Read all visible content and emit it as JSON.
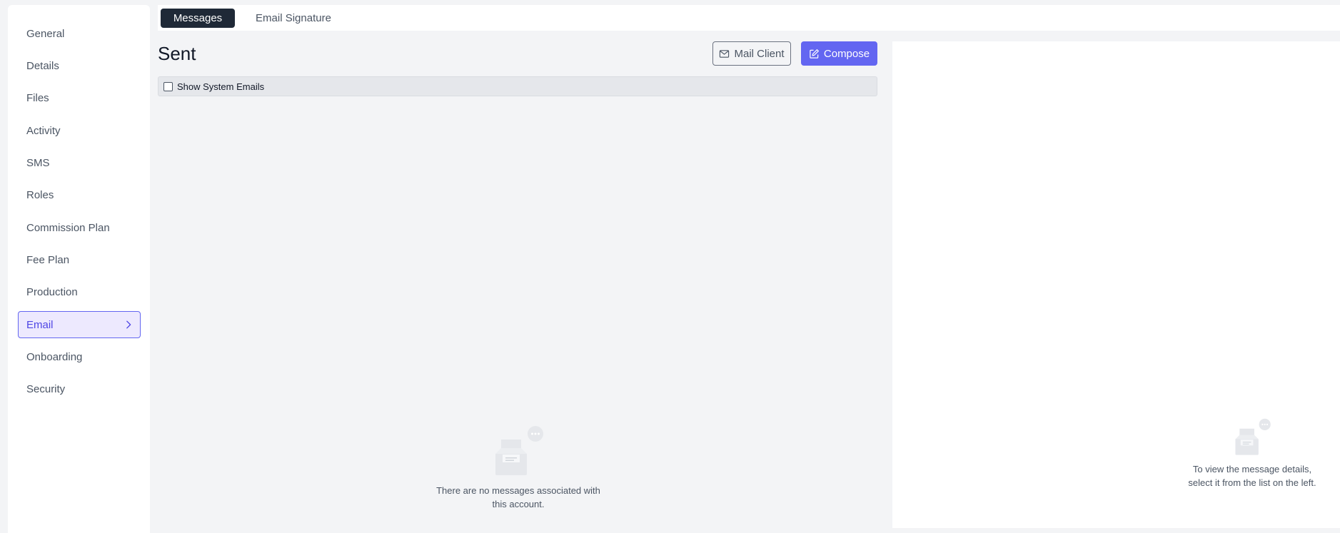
{
  "sidebar": {
    "items": [
      {
        "label": "General"
      },
      {
        "label": "Details"
      },
      {
        "label": "Files"
      },
      {
        "label": "Activity"
      },
      {
        "label": "SMS"
      },
      {
        "label": "Roles"
      },
      {
        "label": "Commission Plan"
      },
      {
        "label": "Fee Plan"
      },
      {
        "label": "Production"
      },
      {
        "label": "Email",
        "active": true
      },
      {
        "label": "Onboarding"
      },
      {
        "label": "Security"
      }
    ]
  },
  "tabs": {
    "messages": "Messages",
    "signature": "Email Signature",
    "active": "Messages"
  },
  "main": {
    "title": "Sent",
    "mail_client_label": "Mail Client",
    "compose_label": "Compose",
    "filter": {
      "show_system_label": "Show System Emails",
      "checked": false
    },
    "empty_message_line1": "There are no messages associated with",
    "empty_message_line2": "this account."
  },
  "detail": {
    "empty_line1": "To view the message details,",
    "empty_line2": "select it from the list on the left."
  },
  "icons": {
    "mail_client": "envelope-icon",
    "compose": "edit-icon",
    "empty_inbox": "inbox-chat-icon",
    "chevron": "chevron-right-icon"
  },
  "colors": {
    "accent": "#6366f1",
    "active_bg": "#ede9fe",
    "dark_tab": "#1f2937",
    "page_bg": "#f3f4f6"
  }
}
